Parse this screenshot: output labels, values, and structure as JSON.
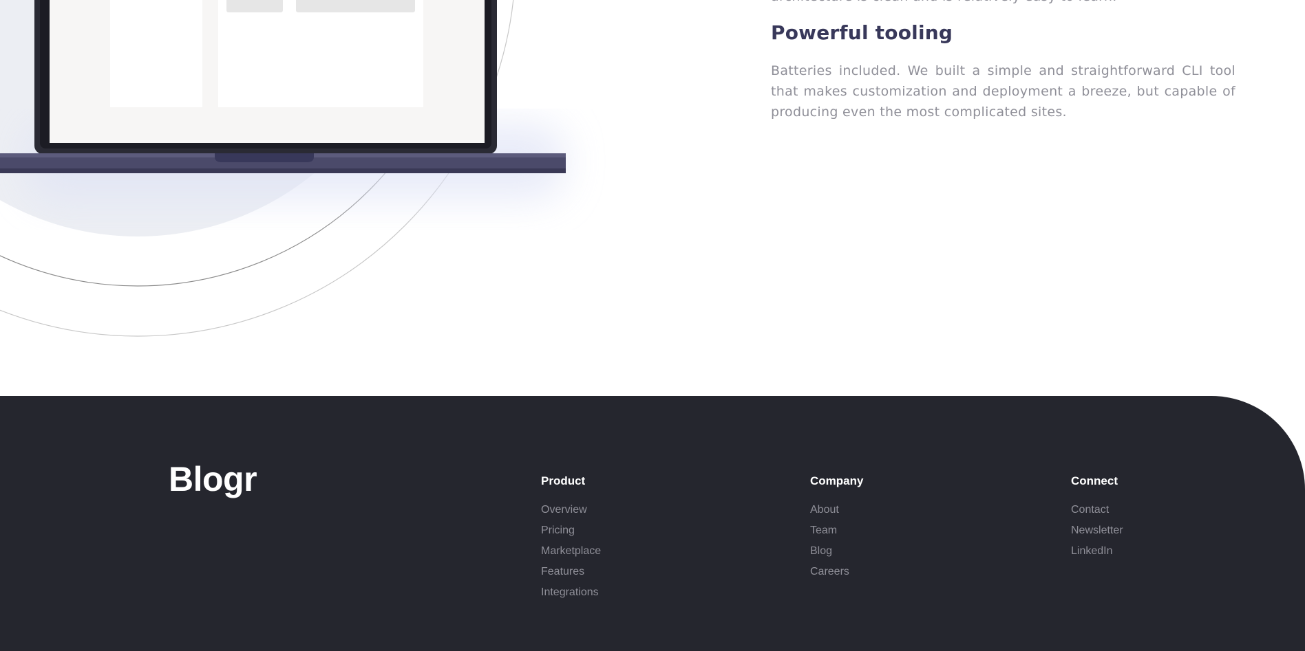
{
  "features": {
    "prev_text": "architecture is clean and is relatively easy to learn.",
    "heading": "Powerful tooling",
    "body": "Batteries included. We built a simple and straightforward CLI tool that makes customization and deployment a breeze, but capable of producing even the most complicated sites."
  },
  "footer": {
    "logo": "Blogr",
    "columns": [
      {
        "heading": "Product",
        "links": [
          "Overview",
          "Pricing",
          "Marketplace",
          "Features",
          "Integrations"
        ]
      },
      {
        "heading": "Company",
        "links": [
          "About",
          "Team",
          "Blog",
          "Careers"
        ]
      },
      {
        "heading": "Connect",
        "links": [
          "Contact",
          "Newsletter",
          "LinkedIn"
        ]
      }
    ]
  },
  "colors": {
    "heading": "#38385a",
    "body_text": "#8f8f98",
    "footer_bg": "#25262e",
    "laptop_body": "#4a4a6a"
  }
}
